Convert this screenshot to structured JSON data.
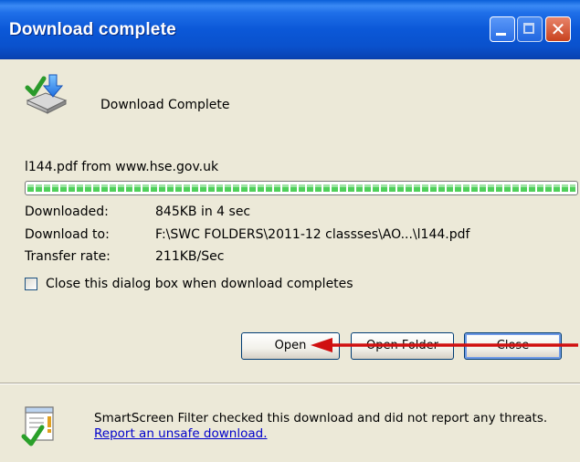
{
  "window": {
    "title": "Download complete"
  },
  "header": {
    "status_text": "Download Complete"
  },
  "file": {
    "source_line": "l144.pdf from www.hse.gov.uk",
    "progress_fraction": 1.0
  },
  "details": {
    "downloaded_label": "Downloaded:",
    "downloaded_value": "845KB in 4 sec",
    "download_to_label": "Download to:",
    "download_to_value": "F:\\SWC FOLDERS\\2011-12 classses\\AO...\\l144.pdf",
    "transfer_rate_label": "Transfer rate:",
    "transfer_rate_value": "211KB/Sec"
  },
  "options": {
    "close_checkbox_label": "Close this dialog box when download completes",
    "close_checkbox_checked": false
  },
  "buttons": {
    "open_label": "Open",
    "open_folder_label": "Open Folder",
    "close_label": "Close"
  },
  "smartscreen": {
    "text": "SmartScreen Filter checked this download and did not report any threats.",
    "link_text": "Report an unsafe download."
  },
  "colors": {
    "title_bar": "#0a51cc",
    "dialog_bg": "#ece9d8",
    "progress_fill": "#4fd05a",
    "annotation_arrow": "#d01010",
    "link": "#0000cc"
  },
  "icons": {
    "title_close": "close-icon",
    "header": "download-complete-icon",
    "smartscreen": "smartscreen-shield-icon"
  }
}
